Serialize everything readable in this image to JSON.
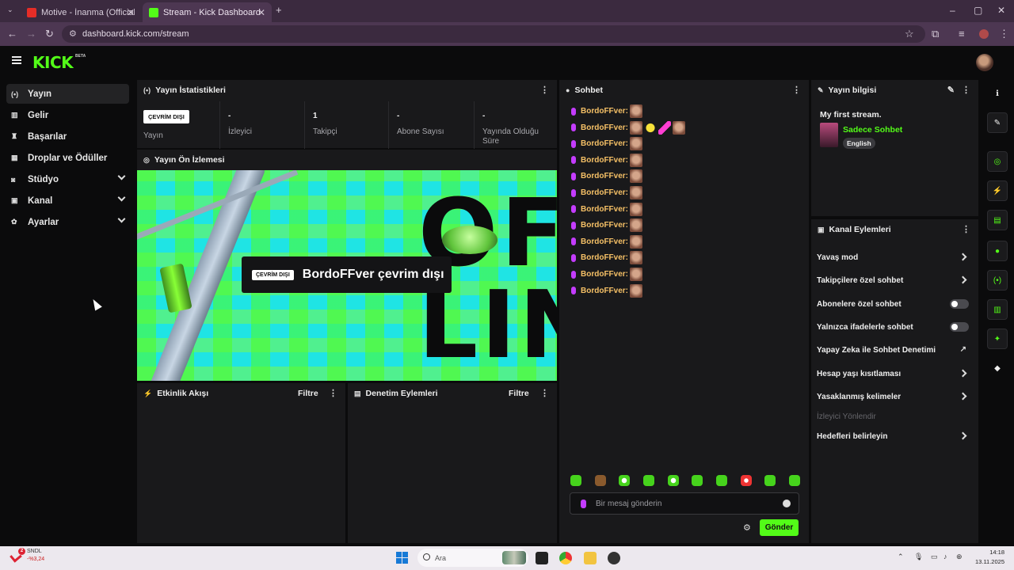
{
  "browser": {
    "tabs": [
      {
        "title": "Motive - İnanma (Official Video)",
        "active": false
      },
      {
        "title": "Stream - Kick Dashboard",
        "active": true
      }
    ],
    "url": "dashboard.kick.com/stream"
  },
  "header": {
    "logo": "KICK",
    "beta": "BETA"
  },
  "sidebar": {
    "items": [
      {
        "label": "Yayın",
        "icon": "broadcast-icon",
        "active": true,
        "expandable": false
      },
      {
        "label": "Gelir",
        "icon": "chart-icon",
        "active": false,
        "expandable": false
      },
      {
        "label": "Başarılar",
        "icon": "trophy-icon",
        "active": false,
        "expandable": false
      },
      {
        "label": "Droplar ve Ödüller",
        "icon": "gift-icon",
        "active": false,
        "expandable": false
      },
      {
        "label": "Stüdyo",
        "icon": "studio-icon",
        "active": false,
        "expandable": true
      },
      {
        "label": "Kanal",
        "icon": "channel-icon",
        "active": false,
        "expandable": true
      },
      {
        "label": "Ayarlar",
        "icon": "gear-icon",
        "active": false,
        "expandable": true
      }
    ]
  },
  "stats": {
    "title": "Yayın İstatistikleri",
    "badge": "ÇEVRİM DIŞI",
    "items": [
      {
        "value": "",
        "label": "Yayın"
      },
      {
        "value": "-",
        "label": "İzleyici"
      },
      {
        "value": "1",
        "label": "Takipçi"
      },
      {
        "value": "-",
        "label": "Abone Sayısı"
      },
      {
        "value": "-",
        "label": "Yayında Olduğu Süre"
      }
    ]
  },
  "preview": {
    "title": "Yayın Ön İzlemesi",
    "art_line1": "OFF-",
    "art_line2": "LINE",
    "badge": "ÇEVRİM DIŞI",
    "text": "BordoFFver çevrim dışı"
  },
  "activity": {
    "title": "Etkinlik Akışı",
    "filter": "Filtre"
  },
  "moderation": {
    "title": "Denetim Eylemleri",
    "filter": "Filtre"
  },
  "chat": {
    "title": "Sohbet",
    "messages": [
      {
        "user": "BordoFFver:"
      },
      {
        "user": "BordoFFver:"
      },
      {
        "user": "BordoFFver:"
      },
      {
        "user": "BordoFFver:"
      },
      {
        "user": "BordoFFver:"
      },
      {
        "user": "BordoFFver:"
      },
      {
        "user": "BordoFFver:"
      },
      {
        "user": "BordoFFver:"
      },
      {
        "user": "BordoFFver:"
      },
      {
        "user": "BordoFFver:"
      },
      {
        "user": "BordoFFver:"
      },
      {
        "user": "BordoFFver:"
      }
    ],
    "placeholder": "Bir mesaj gönderin",
    "send": "Gönder"
  },
  "stream_info": {
    "title": "Yayın bilgisi",
    "stream_title": "My first stream.",
    "category": "Sadece Sohbet",
    "language": "English"
  },
  "channel_actions": {
    "title": "Kanal Eylemleri",
    "items": [
      {
        "label": "Yavaş mod",
        "control": "arrow",
        "enabled": true
      },
      {
        "label": "Takipçilere özel sohbet",
        "control": "arrow",
        "enabled": true
      },
      {
        "label": "Abonelere özel sohbet",
        "control": "toggle",
        "enabled": true
      },
      {
        "label": "Yalnızca ifadelerle sohbet",
        "control": "toggle",
        "enabled": true
      },
      {
        "label": "Yapay Zeka ile Sohbet Denetimi",
        "control": "external",
        "enabled": true
      },
      {
        "label": "Hesap yaşı kısıtlaması",
        "control": "arrow",
        "enabled": true
      },
      {
        "label": "Yasaklanmış kelimeler",
        "control": "arrow",
        "enabled": true
      },
      {
        "label": "İzleyici Yönlendir",
        "control": "none",
        "enabled": false
      },
      {
        "label": "Hedefleri belirleyin",
        "control": "arrow",
        "enabled": true
      }
    ]
  },
  "taskbar": {
    "stock_name": "SNDL",
    "stock_change": "-%3,24",
    "weather_badge": "2",
    "search": "Ara",
    "time": "14:18",
    "date": "13.11.2025"
  },
  "colors": {
    "accent": "#53fc18",
    "panel": "#19191b",
    "username": "#f5c066"
  }
}
